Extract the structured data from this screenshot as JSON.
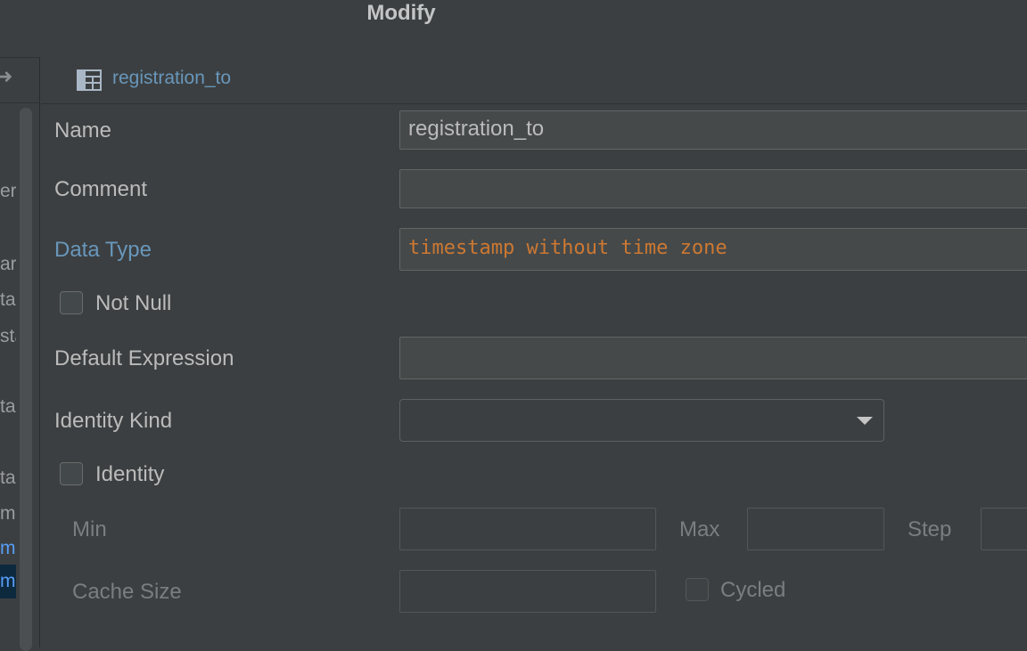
{
  "window": {
    "title": "Modify"
  },
  "tree": {
    "fragments": [
      "er",
      "ar",
      "ta",
      "sta",
      "ta",
      "ta",
      "mp",
      "m",
      "m"
    ]
  },
  "header": {
    "object_name": "registration_to"
  },
  "form": {
    "name_label": "Name",
    "name_value": "registration_to",
    "comment_label": "Comment",
    "comment_value": "",
    "data_type_label": "Data Type",
    "data_type_value": "timestamp without time zone",
    "not_null_label": "Not Null",
    "not_null_checked": false,
    "default_expression_label": "Default Expression",
    "default_expression_value": "",
    "identity_kind_label": "Identity Kind",
    "identity_kind_value": "",
    "identity_label": "Identity",
    "identity_checked": false,
    "min_label": "Min",
    "max_label": "Max",
    "step_label": "Step",
    "cache_size_label": "Cache Size",
    "cycled_label": "Cycled",
    "cycled_checked": false
  },
  "colors": {
    "background": "#3c3f41",
    "accent_blue": "#6897bb",
    "type_orange": "#cc7832"
  },
  "icons": [
    "chevron-right-icon",
    "table-icon",
    "chevron-down-icon"
  ]
}
